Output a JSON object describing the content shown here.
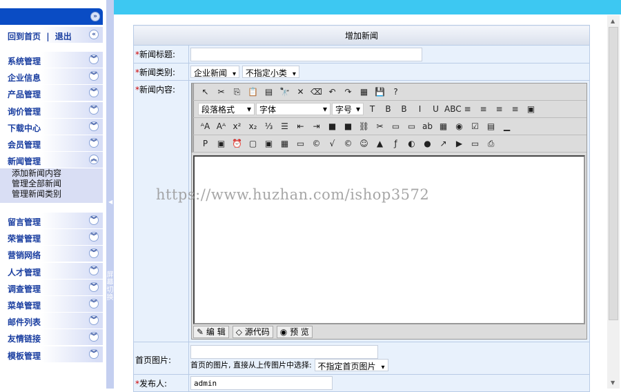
{
  "sidebar": {
    "home": "回到首页",
    "sep": "|",
    "logout": "退出",
    "menus": [
      "系统管理",
      "企业信息",
      "产品管理",
      "询价管理",
      "下载中心",
      "会员管理",
      "新闻管理"
    ],
    "submenu": [
      "添加新闻内容",
      "管理全部新闻",
      "管理新闻类别"
    ],
    "menus2": [
      "留言管理",
      "荣誉管理",
      "营销网络",
      "人才管理",
      "调查管理",
      "菜单管理",
      "邮件列表",
      "友情链接",
      "模板管理"
    ]
  },
  "splitter": {
    "label": "屏幕切换"
  },
  "form": {
    "title": "增加新闻",
    "news_title_label": "新闻标题:",
    "news_title_value": "",
    "category_label": "新闻类别:",
    "category": "企业新闻",
    "subcategory": "不指定小类",
    "content_label": "新闻内容:",
    "image_label": "首页图片:",
    "image_value": "",
    "image_hint": "首页的图片, 直接从上传图片中选择:",
    "image_select": "不指定首页图片",
    "publisher_label": "发布人:",
    "publisher_value": "admin"
  },
  "editor": {
    "format": "段落格式",
    "font": "字体",
    "size": "字号",
    "row1": [
      "↖",
      "✂",
      "⎘",
      "📋",
      "▤",
      "🔭",
      "✕",
      "⌫",
      "↶",
      "↷",
      "▦",
      "💾",
      "?"
    ],
    "row2": [
      "T",
      "B",
      "B",
      "I",
      "U",
      "ABC",
      "≡",
      "≡",
      "≡",
      "≡",
      "▣"
    ],
    "row3": [
      "ᴬA",
      "Aᴬ",
      "x²",
      "x₂",
      "⅓",
      "☰",
      "⇤",
      "⇥",
      "■",
      "■",
      "⛓",
      "✂",
      "▭",
      "▭",
      "ab",
      "▦",
      "◉",
      "☑",
      "▤",
      "▁"
    ],
    "row4": [
      "P",
      "▣",
      "⏰",
      "▢",
      "▣",
      "▦",
      "▭",
      "©",
      "√",
      "©",
      "☺",
      "▲",
      "ƒ",
      "◐",
      "●",
      "↗",
      "▶",
      "▭",
      "⎙"
    ],
    "tabs": [
      "编 辑",
      "源代码",
      "预 览"
    ]
  },
  "watermark": "https://www.huzhan.com/ishop3572"
}
